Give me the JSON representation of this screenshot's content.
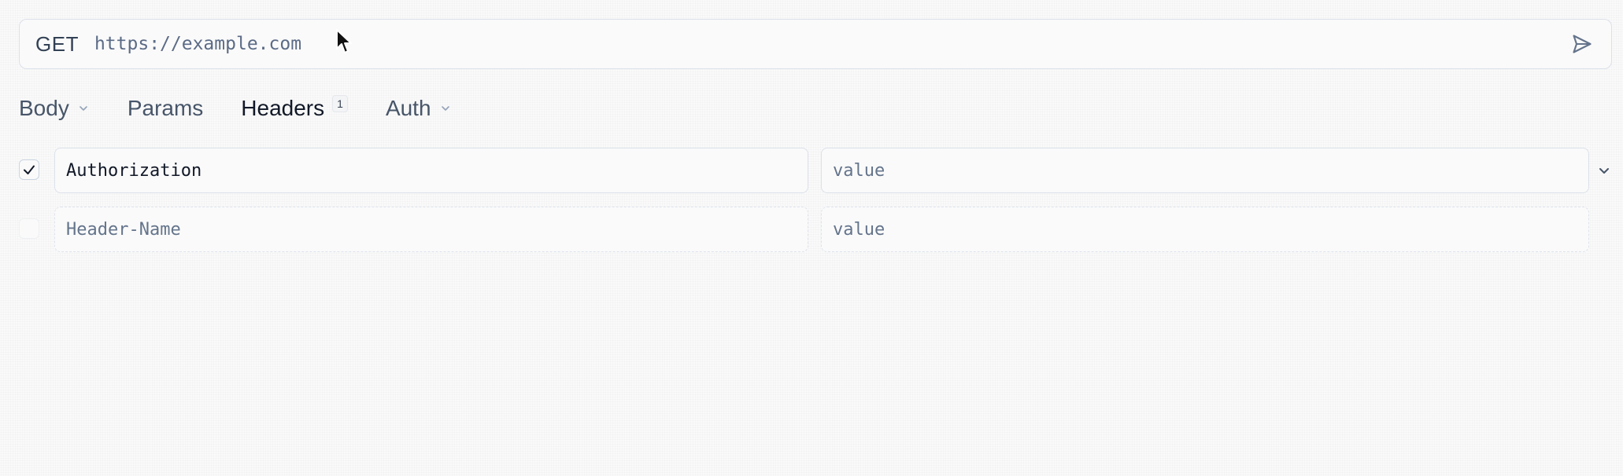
{
  "request": {
    "method": "GET",
    "url_placeholder": "https://example.com"
  },
  "tabs": [
    {
      "label": "Body",
      "has_dropdown": true
    },
    {
      "label": "Params"
    },
    {
      "label": "Headers",
      "badge": "1",
      "active": true
    },
    {
      "label": "Auth",
      "has_dropdown": true
    }
  ],
  "headers": [
    {
      "enabled": true,
      "name": "Authorization",
      "value_placeholder": "value"
    },
    {
      "enabled": false,
      "name_placeholder": "Header-Name",
      "value_placeholder": "value"
    }
  ],
  "colors": {
    "background": "#fafafa",
    "border": "#dbe1ea",
    "text": "#111827",
    "muted_text": "#64748b"
  },
  "icons": {
    "send": "send-icon",
    "check": "check-icon",
    "chevron": "chevron-down-icon",
    "cursor": "mouse-pointer-icon"
  }
}
